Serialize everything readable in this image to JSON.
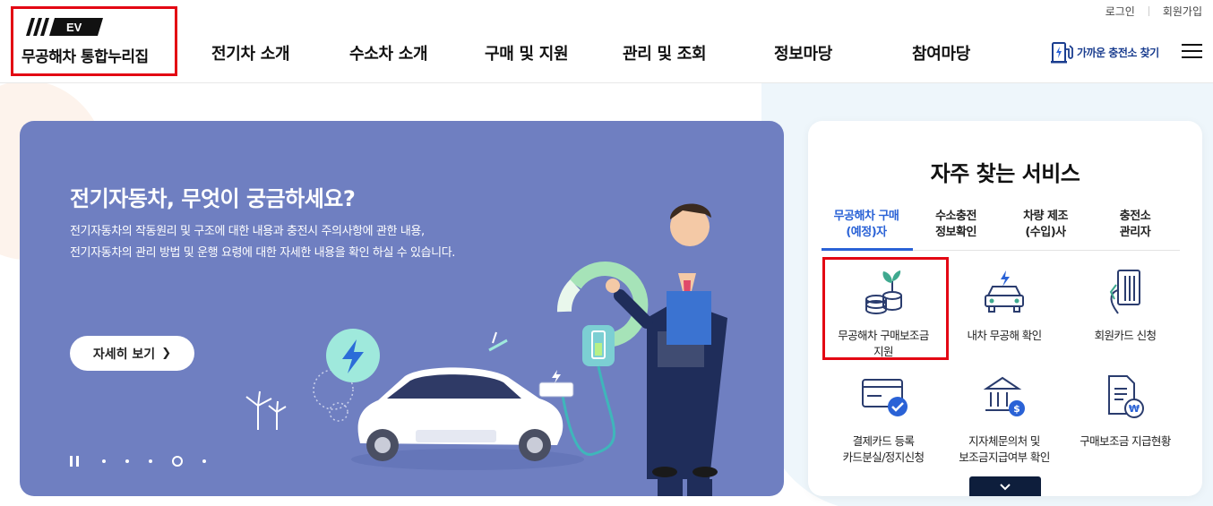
{
  "brand": {
    "mark": "EV",
    "name": "무공해차 통합누리집",
    "accent": "#e30613"
  },
  "util": {
    "login": "로그인",
    "join": "회원가입"
  },
  "gnb": [
    "전기차 소개",
    "수소차 소개",
    "구매 및 지원",
    "관리 및 조회",
    "정보마당",
    "참여마당"
  ],
  "find_station": "가까운 충전소 찾기",
  "hero": {
    "title": "전기자동차, 무엇이 궁금하세요?",
    "desc_line1": "전기자동차의 작동원리 및 구조에 대한 내용과 충전시 주의사항에 관한 내용,",
    "desc_line2": "전기자동차의 관리 방법 및 운행 요령에 대한 자세한 내용을 확인 하실 수 있습니다.",
    "button": "자세히 보기",
    "bg_color": "#6f7fc1",
    "slides_total": 5,
    "slide_active": 4
  },
  "services": {
    "title": "자주 찾는 서비스",
    "tabs": [
      {
        "line1": "무공해차 구매",
        "line2": "(예정)자",
        "active": true
      },
      {
        "line1": "수소충전",
        "line2": "정보확인",
        "active": false
      },
      {
        "line1": "차량 제조",
        "line2": "(수입)사",
        "active": false
      },
      {
        "line1": "충전소",
        "line2": "관리자",
        "active": false
      }
    ],
    "items": [
      {
        "icon": "coins-plant-icon",
        "line1": "무공해차 구매보조금",
        "line2": "지원"
      },
      {
        "icon": "ev-car-icon",
        "line1": "내차 무공해 확인",
        "line2": ""
      },
      {
        "icon": "member-card-icon",
        "line1": "회원카드 신청",
        "line2": ""
      },
      {
        "icon": "payment-card-check-icon",
        "line1": "결제카드 등록",
        "line2": "카드분실/정지신청"
      },
      {
        "icon": "bank-won-icon",
        "line1": "지자체문의처 및",
        "line2": "보조금지급여부 확인"
      },
      {
        "icon": "document-won-icon",
        "line1": "구매보조금 지급현황",
        "line2": ""
      }
    ],
    "accent": "#2a62d6"
  }
}
